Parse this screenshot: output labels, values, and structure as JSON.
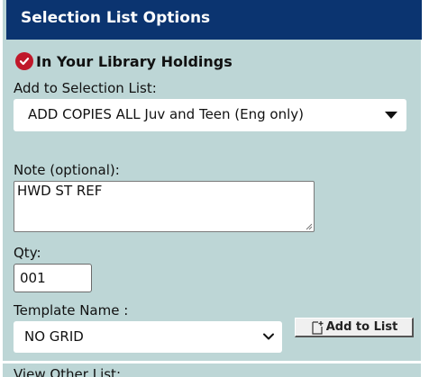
{
  "panel": {
    "title": "Selection List Options"
  },
  "holdings": {
    "status_icon": "check-circle-icon",
    "status_color": "#c0182a",
    "text": "In Your Library Holdings"
  },
  "selection_list": {
    "label": "Add to Selection List:",
    "selected": "ADD COPIES ALL Juv and Teen (Eng only)"
  },
  "note": {
    "label": "Note (optional):",
    "value": "HWD ST REF"
  },
  "qty": {
    "label": "Qty:",
    "value": "001"
  },
  "template": {
    "label": "Template Name :",
    "selected": "NO GRID"
  },
  "add_button": {
    "label": "Add to List",
    "icon": "add-document-icon"
  },
  "view_other": {
    "label": "View Other List:"
  },
  "colors": {
    "panel_bg": "#bdd6d6",
    "header_bg": "#0b3470",
    "header_text": "#ffffff"
  }
}
